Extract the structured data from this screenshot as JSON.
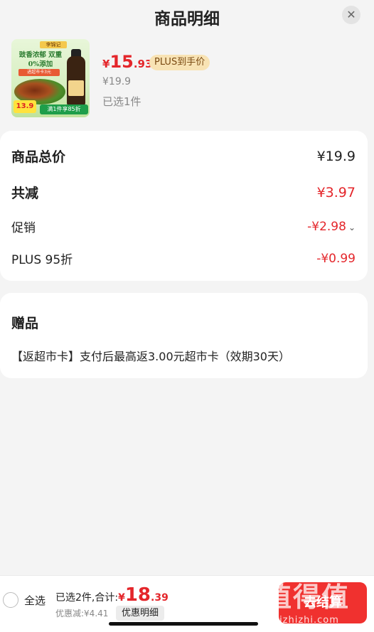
{
  "header": {
    "title": "商品明细",
    "close_icon": "close-icon"
  },
  "product": {
    "image": {
      "brand": "李锦记",
      "slogan": "豉香浓郁 双重0%添加",
      "tag": "进超市卡3元",
      "price_badge": "13.9",
      "promo": "满1件享85折"
    },
    "price_currency": "¥",
    "price_int": "15",
    "price_dec": ".93",
    "plus_badge": "PLUS到手价",
    "original_price": "¥19.9",
    "selected": "已选1件"
  },
  "summary": {
    "total_label": "商品总价",
    "total_value": "¥19.9",
    "reduce_label": "共减",
    "reduce_value": "¥3.97",
    "promo_label": "促销",
    "promo_value": "-¥2.98",
    "plus_label": "PLUS 95折",
    "plus_value": "-¥0.99"
  },
  "gift": {
    "title": "赠品",
    "text": "【返超市卡】支付后最高返3.00元超市卡（效期30天）"
  },
  "footer": {
    "select_all": "全选",
    "selected_total_text": "已选2件,合计:",
    "total_currency": "¥",
    "total_int": "18",
    "total_dec": ".39",
    "discount": "优惠减:¥4.41",
    "detail_button": "优惠明细",
    "checkout_button": "去结算"
  },
  "watermark": {
    "main": "值得值",
    "sub": "znjzhizhi.com"
  },
  "colors": {
    "accent_red": "#e4262b",
    "checkout_red": "#f0312f",
    "plus_gold": "#f8e3b4"
  }
}
